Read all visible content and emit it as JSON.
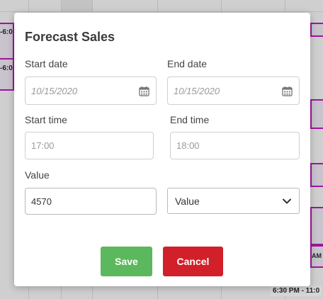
{
  "background": {
    "events": [
      {
        "text": "-6:0"
      },
      {
        "text": "-6:0"
      },
      {
        "text": "AM"
      },
      {
        "text": "AM"
      }
    ],
    "tag": "6:30 PM - 11:0"
  },
  "modal": {
    "title": "Forecast Sales",
    "start_date": {
      "label": "Start date",
      "value": "10/15/2020"
    },
    "end_date": {
      "label": "End date",
      "value": "10/15/2020"
    },
    "start_time": {
      "label": "Start time",
      "value": "17:00"
    },
    "end_time": {
      "label": "End time",
      "value": "18:00"
    },
    "value_field": {
      "label": "Value",
      "value": "4570"
    },
    "value_type": {
      "selected": "Value"
    },
    "buttons": {
      "save": "Save",
      "cancel": "Cancel"
    }
  },
  "colors": {
    "save": "#5cb85c",
    "cancel": "#d2202a",
    "event_border": "#a0159b"
  },
  "icons": {
    "date": "calendar-icon",
    "select": "chevron-down-icon"
  }
}
